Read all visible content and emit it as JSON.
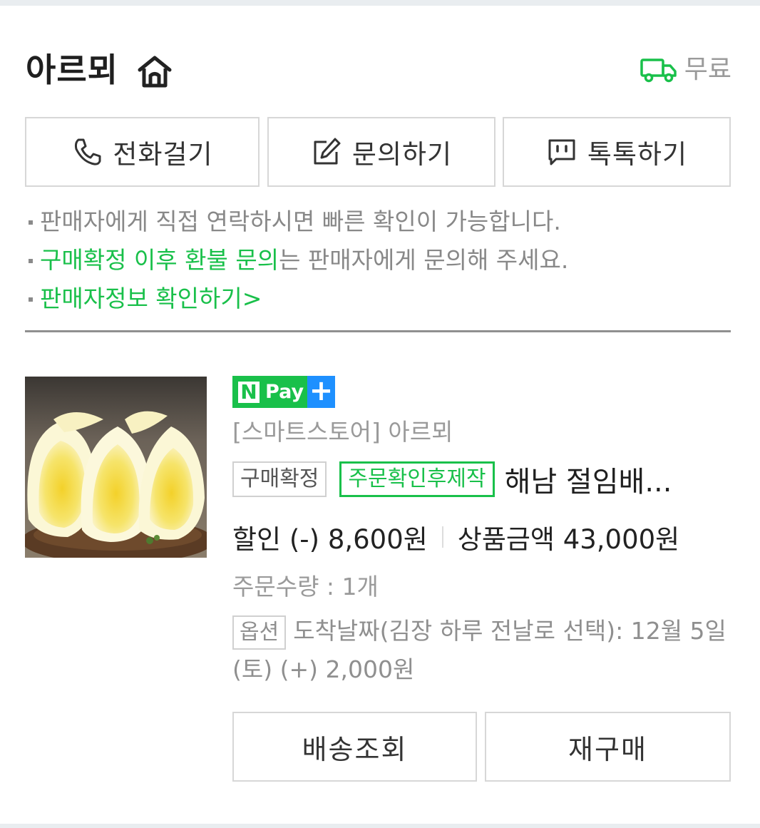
{
  "header": {
    "store_name": "아르뫼",
    "home_icon": "home-icon",
    "shipping_icon": "truck-icon",
    "shipping_label": "무료"
  },
  "contact": {
    "call_label": "전화걸기",
    "ask_label": "문의하기",
    "talk_label": "톡톡하기",
    "call_icon": "phone-icon",
    "ask_icon": "edit-icon",
    "talk_icon": "chat-icon"
  },
  "notes": {
    "line1": "판매자에게 직접 연락하시면 빠른 확인이 가능합니다.",
    "line2_link": "구매확정 이후 환불 문의",
    "line2_rest": "는 판매자에게 문의해 주세요.",
    "line3_link": "판매자정보 확인하기",
    "line3_arrow": ">"
  },
  "product": {
    "npay_n": "N",
    "npay_pay": "Pay",
    "npay_plus": "+",
    "store_line": "[스마트스토어] 아르뫼",
    "status_badge": "구매확정",
    "made_badge": "주문확인후제작",
    "title": "해남 절임배...",
    "discount": "할인 (-) 8,600원",
    "amount": "상품금액 43,000원",
    "quantity": "주문수량 : 1개",
    "option_badge": "옵션",
    "option_text": "도착날짜(김장 하루 전날로 선택): 12월 5일(토) (+) 2,000원"
  },
  "actions": {
    "track_label": "배송조회",
    "rebuy_label": "재구매"
  },
  "colors": {
    "accent_green": "#19c04a",
    "npay_blue": "#1e90ff"
  }
}
